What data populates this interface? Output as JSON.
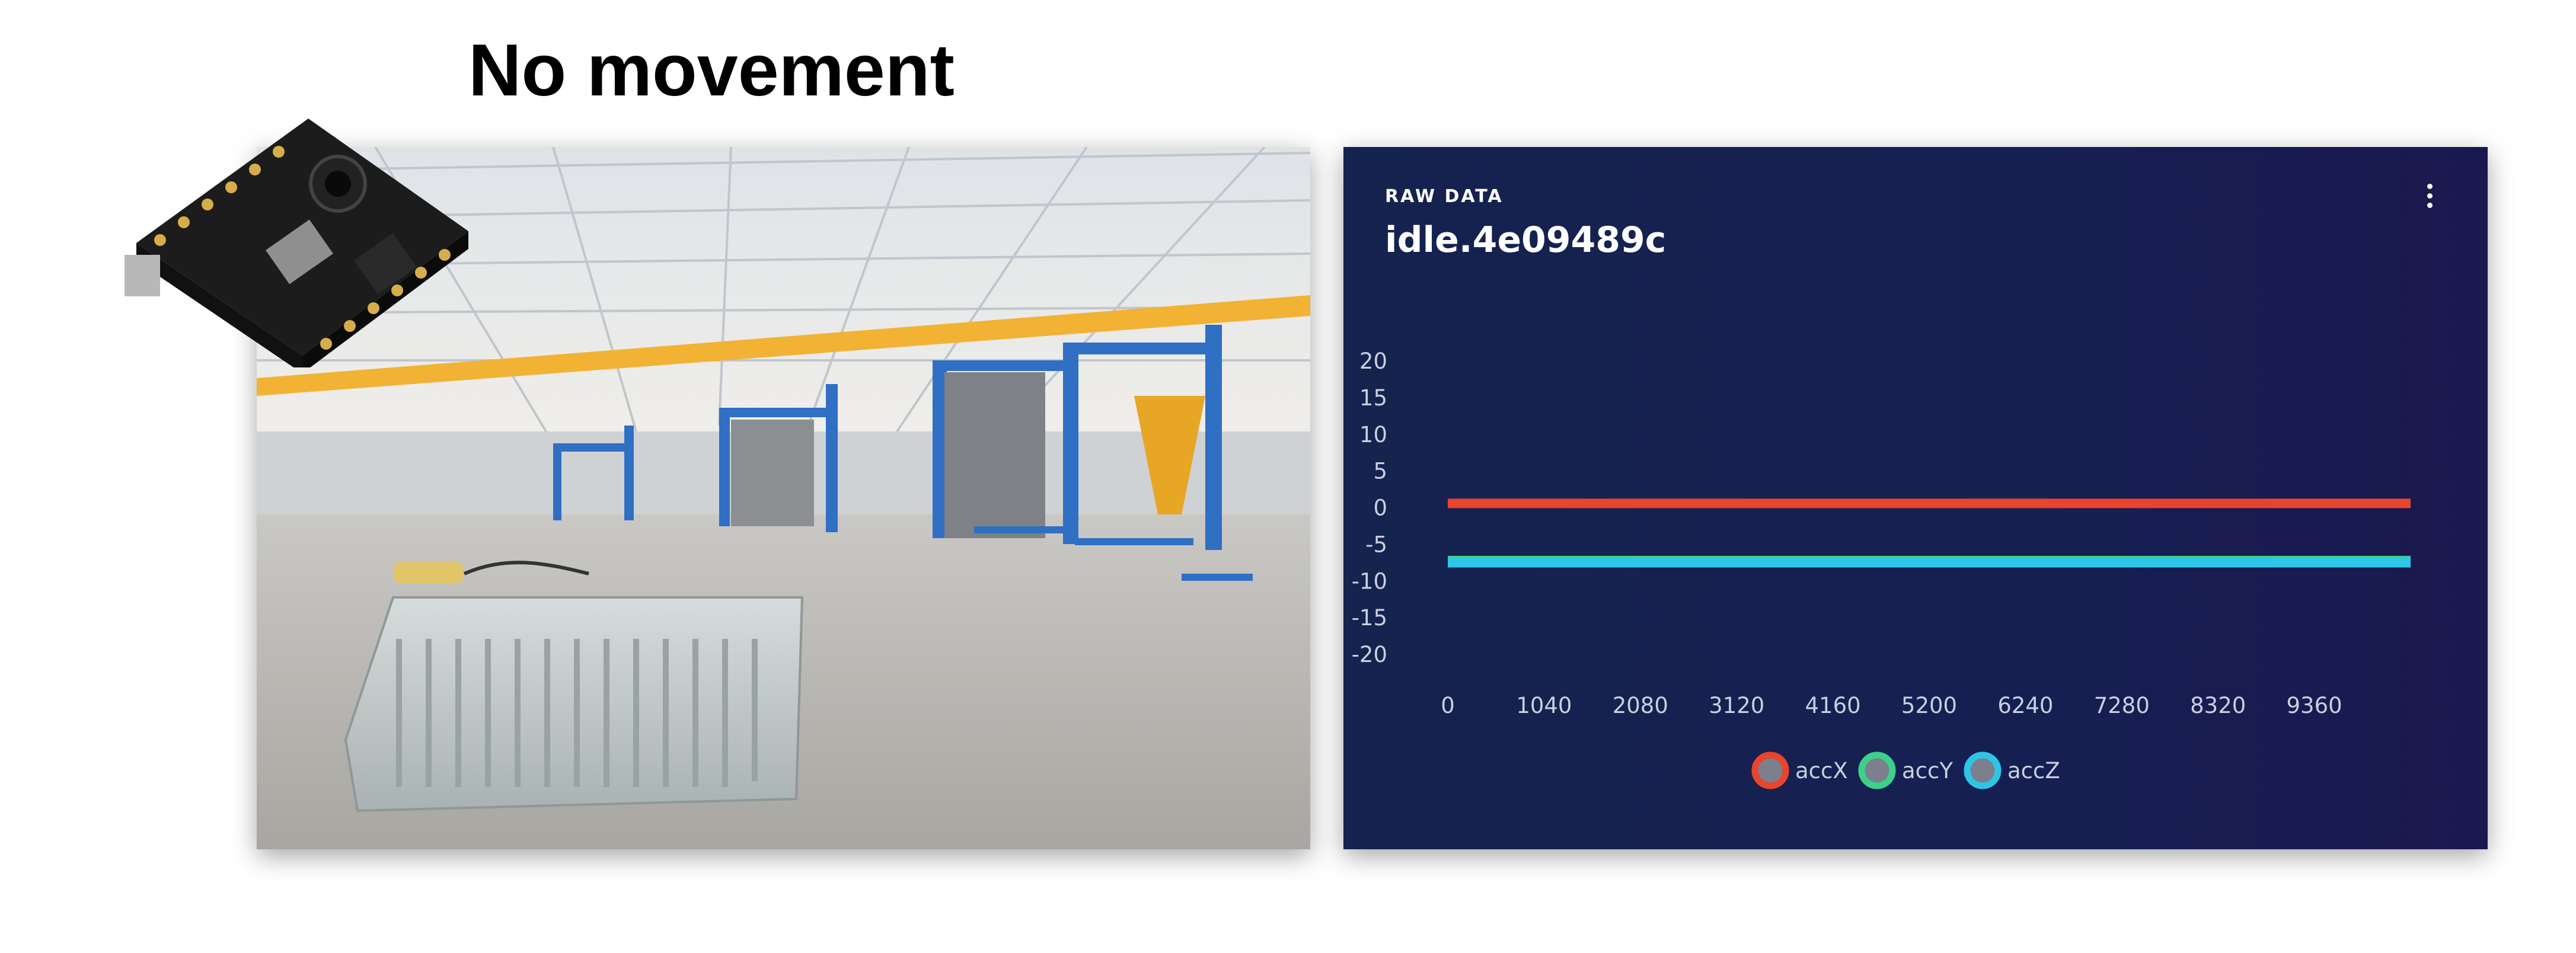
{
  "heading": "No movement",
  "panel": {
    "kicker": "RAW DATA",
    "title": "idle.4e09489c"
  },
  "chart_data": {
    "type": "line",
    "title": "",
    "xlabel": "",
    "ylabel": "",
    "x_ticks": [
      0,
      1040,
      2080,
      3120,
      4160,
      5200,
      6240,
      7280,
      8320,
      9360
    ],
    "y_ticks": [
      20,
      15,
      10,
      5,
      0,
      -5,
      -10,
      -15,
      -20
    ],
    "xlim": [
      0,
      10400
    ],
    "ylim": [
      -20,
      20
    ],
    "grid": false,
    "legend_position": "bottom",
    "series": [
      {
        "name": "accX",
        "color": "#e8452c",
        "x": [
          0,
          10400
        ],
        "y": [
          0.5,
          0.5
        ]
      },
      {
        "name": "accY",
        "color": "#3ad28b",
        "x": [
          0,
          10400
        ],
        "y": [
          -7.3,
          -7.3
        ]
      },
      {
        "name": "accZ",
        "color": "#2ec6e6",
        "x": [
          0,
          10400
        ],
        "y": [
          -7.6,
          -7.6
        ]
      }
    ]
  }
}
